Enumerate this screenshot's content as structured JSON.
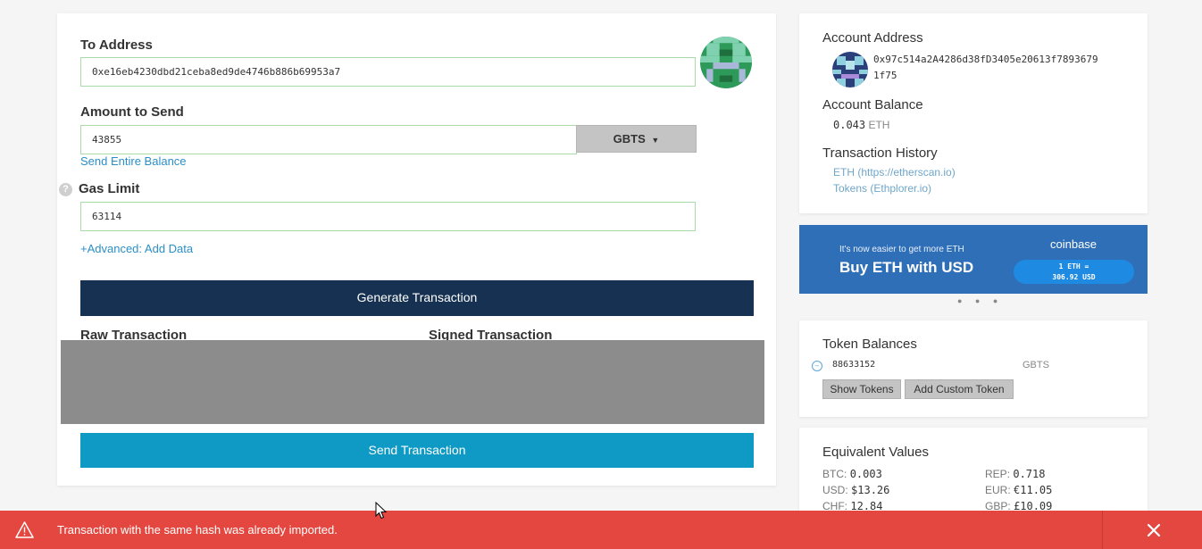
{
  "form": {
    "to_address_label": "To Address",
    "to_address_value": "0xe16eb4230dbd21ceba8ed9de4746b886b69953a7",
    "amount_label": "Amount to Send",
    "amount_value": "43855",
    "token_select": "GBTS",
    "send_entire_balance": "Send Entire Balance",
    "gas_limit_label": "Gas Limit",
    "gas_limit_value": "63114",
    "help_symbol": "?",
    "advanced_link": "+Advanced: Add Data",
    "generate_button": "Generate Transaction",
    "raw_tx_label": "Raw Transaction",
    "signed_tx_label": "Signed Transaction",
    "send_button": "Send Transaction"
  },
  "account": {
    "address_title": "Account Address",
    "address_line1": "0x97c514a2A4286d38fD3405e20613f7893679",
    "address_line2": "1f75",
    "balance_title": "Account Balance",
    "balance_value": "0.043",
    "balance_unit": "ETH",
    "history_title": "Transaction History",
    "history_eth": "ETH (https://etherscan.io)",
    "history_tokens": "Tokens (Ethplorer.io)"
  },
  "banner": {
    "small_text": "It's now easier to get more ETH",
    "big_text": "Buy ETH with USD",
    "brand": "coinbase",
    "rate_line1": "1 ETH =",
    "rate_line2": "306.92 USD",
    "bg_color": "#2f6fb8"
  },
  "tokens": {
    "title": "Token Balances",
    "balance": "88633152",
    "symbol": "GBTS",
    "show_tokens": "Show Tokens",
    "add_custom": "Add Custom Token"
  },
  "equivalent": {
    "title": "Equivalent Values",
    "items": [
      {
        "label": "BTC:",
        "value": "0.003"
      },
      {
        "label": "REP:",
        "value": "0.718"
      },
      {
        "label": "USD:",
        "value": "$13.26"
      },
      {
        "label": "EUR:",
        "value": "€11.05"
      },
      {
        "label": "CHF:",
        "value": "12.84"
      },
      {
        "label": "GBP:",
        "value": "£10.09"
      }
    ]
  },
  "alert": {
    "message": "Transaction with the same hash was already imported.",
    "color": "#e4473f"
  }
}
